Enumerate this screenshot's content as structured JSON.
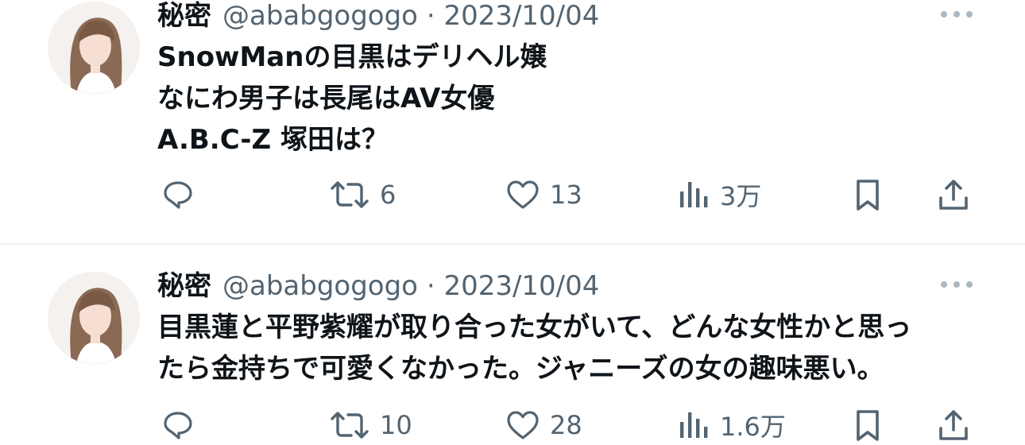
{
  "colors": {
    "text_primary": "#0f1419",
    "text_secondary": "#536471",
    "divider": "#eff3f4"
  },
  "icons": {
    "reply": "reply-icon",
    "retweet": "retweet-icon",
    "like": "heart-icon",
    "views": "views-icon",
    "bookmark": "bookmark-icon",
    "share": "share-icon",
    "more": "more-options-icon"
  },
  "tweets": [
    {
      "name": "秘密",
      "handle": "@ababgogogo",
      "separator": "·",
      "date": "2023/10/04",
      "lines": [
        "SnowManの目黒はデリヘル嬢",
        "なにわ男子は長尾はAV女優",
        "A.B.C-Z 塚田は？"
      ],
      "actions": {
        "reply_count": "",
        "retweet_count": "6",
        "like_count": "13",
        "views_count": "3万"
      }
    },
    {
      "name": "秘密",
      "handle": "@ababgogogo",
      "separator": "·",
      "date": "2023/10/04",
      "lines": [
        "目黒蓮と平野紫耀が取り合った女がいて、どんな女性かと思っ",
        "たら金持ちで可愛くなかった。ジャニーズの女の趣味悪い。"
      ],
      "actions": {
        "reply_count": "",
        "retweet_count": "10",
        "like_count": "28",
        "views_count": "1.6万"
      }
    }
  ]
}
